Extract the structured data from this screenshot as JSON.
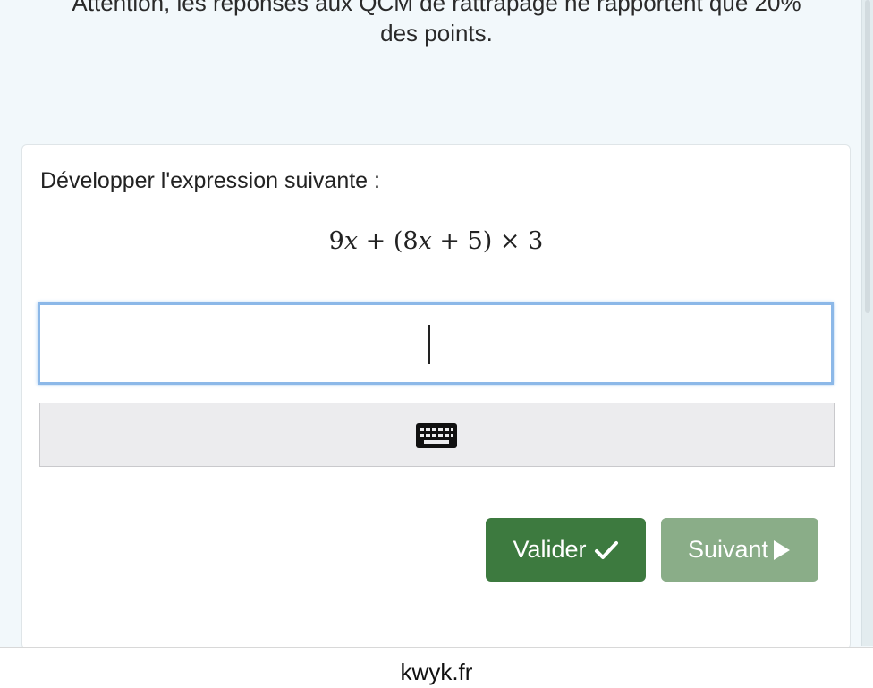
{
  "notice": {
    "line1": "Attention, les réponses aux QCM de rattrapage ne rapportent que 20%",
    "line2": "des points."
  },
  "exercise": {
    "prompt": "Développer l'expression suivante :",
    "expression": {
      "c1": "9",
      "v1": "x",
      "op1": " + (",
      "c2": "8",
      "v2": "x",
      "op2": " + 5) × 3"
    },
    "answer_value": ""
  },
  "keyboard_toggle": {
    "icon": "keyboard-icon"
  },
  "buttons": {
    "validate": "Valider",
    "validate_icon": "check-icon",
    "next": "Suivant",
    "next_icon": "play-triangle-icon"
  },
  "footer": {
    "url": "kwyk.fr"
  },
  "colors": {
    "validate_bg": "#3d7a3f",
    "next_bg": "#8aad88",
    "input_border": "#8cb8e8",
    "page_bg": "#f2f8fb"
  }
}
